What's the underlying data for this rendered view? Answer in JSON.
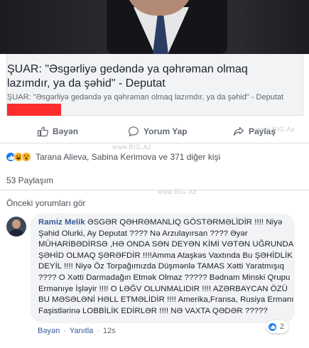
{
  "link": {
    "title": "ŞUAR: \"Əsgərliyə gedəndə ya qəhrəman olmaq lazımdır, ya da şəhid\" - Deputat",
    "subtitle": "ŞUAR: \"Əsgərliyə gedəndə ya qəhrəman olmaq lazımdır, ya da şəhid\" - Deputat"
  },
  "actions": {
    "like": "Bəyən",
    "comment": "Yorum Yap",
    "share": "Paylaş"
  },
  "watermark": "www.BIG.Az",
  "reactions": {
    "text": "Tarana Alieva, Sabina Kerimova ve 371 diğer kişi",
    "icons": [
      "like-icon",
      "haha-icon",
      "wow-icon"
    ]
  },
  "shares": "53 Paylaşım",
  "previous_comments": "Önceki yorumları gör",
  "comment": {
    "author": "Ramiz Melik",
    "text": "ƏSGƏR QƏHRƏMANLIQ GÖSTƏRMƏLİDİR !!!! Niyə Şəhid Olurki, Ay Deputat ???? Nə Arzulayırsan ???? Əyər MÜHARİBƏDİRSƏ ,HƏ ONDA SƏN DEYƏN KİMİ VƏTƏN UĞRUNDA ŞƏHİD OLMAQ ŞƏRƏFDİR !!!!Amma Ataşkəs Vaxtında Bu ŞƏHİDLİK DEYİL !!!! Niyə Öz Torpağımızda Düşmənlə TAMAS Xətti Yaratmışıq ???? O Xətti Darmadağın Etmək Olmaz ????? Bədnam Minski Qrupu Ermənıye İşləyir !!!! O LƏĞV OLUNMALIDIR !!!! AZƏRBAYCAN ÖZÜ BU MƏSƏLƏNİ HƏLL ETMƏLİDİR !!!! Amerika,Fransa, Rusiya Ermənı Faşistlərinə LOBBİLİK EDİRLƏR !!!! NƏ VAXTA QƏDƏR ?????",
    "reaction_count": "2",
    "like_label": "Bəyən",
    "reply_label": "Yanıtla",
    "time": "12s"
  },
  "colors": {
    "accent": "#385898",
    "like_blue": "#1877f2",
    "red_bar": "#fb2c2c"
  }
}
